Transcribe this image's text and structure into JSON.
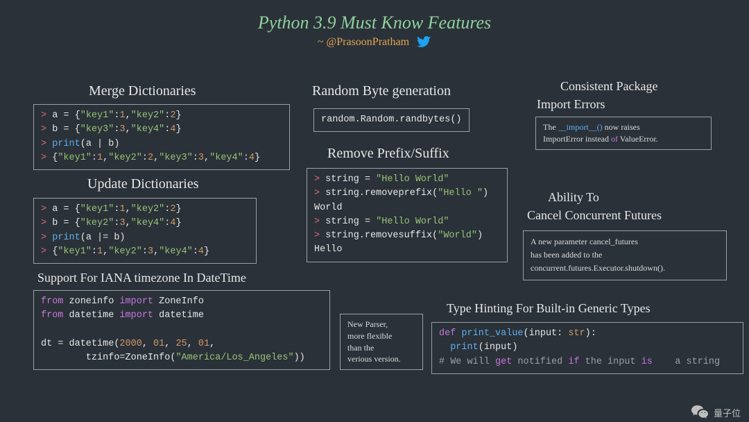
{
  "header": {
    "title": "Python 3.9 Must Know Features",
    "subtitle": "~ @PrasoonPratham"
  },
  "sections": {
    "merge_dict": {
      "heading": "Merge Dictionaries"
    },
    "update_dict": {
      "heading": "Update Dictionaries"
    },
    "iana": {
      "heading": "Support For IANA timezone In DateTime"
    },
    "random_byte": {
      "heading": "Random Byte generation",
      "code": "random.Random.randbytes()"
    },
    "remove_pre_suf": {
      "heading": "Remove Prefix/Suffix"
    },
    "consistent_pkg": {
      "heading_line1": "Consistent Package",
      "heading_line2": "Import Errors"
    },
    "cancel_futures": {
      "heading_line1": "Ability To",
      "heading_line2": "Cancel Concurrent Futures"
    },
    "type_hint": {
      "heading": "Type Hinting For Built-in Generic Types"
    }
  },
  "code": {
    "merge": {
      "l1_a": "> ",
      "l1_b": "a = {",
      "l1_c": "\"key1\"",
      "l1_d": ":",
      "l1_e": "1",
      "l1_f": ",",
      "l1_g": "\"key2\"",
      "l1_h": ":",
      "l1_i": "2",
      "l1_j": "}",
      "l2_a": "> ",
      "l2_b": "b = {",
      "l2_c": "\"key3\"",
      "l2_d": ":",
      "l2_e": "3",
      "l2_f": ",",
      "l2_g": "\"key4\"",
      "l2_h": ":",
      "l2_i": "4",
      "l2_j": "}",
      "l3_a": "> ",
      "l3_b": "print",
      "l3_c": "(a | b)",
      "l4_a": "> ",
      "l4_b": "{",
      "l4_c": "\"key1\"",
      "l4_d": ":",
      "l4_e": "1",
      "l4_f": ",",
      "l4_g": "\"key2\"",
      "l4_h": ":",
      "l4_i": "2",
      "l4_j": ",",
      "l4_k": "\"key3\"",
      "l4_l": ":",
      "l4_m": "3",
      "l4_n": ",",
      "l4_o": "\"key4\"",
      "l4_p": ":",
      "l4_q": "4",
      "l4_r": "}"
    },
    "update": {
      "l1_a": "> ",
      "l1_b": "a = {",
      "l1_c": "\"key1\"",
      "l1_d": ":",
      "l1_e": "1",
      "l1_f": ",",
      "l1_g": "\"key2\"",
      "l1_h": ":",
      "l1_i": "2",
      "l1_j": "}",
      "l2_a": "> ",
      "l2_b": "b = {",
      "l2_c": "\"key2\"",
      "l2_d": ":",
      "l2_e": "3",
      "l2_f": ",",
      "l2_g": "\"key4\"",
      "l2_h": ":",
      "l2_i": "4",
      "l2_j": "}",
      "l3_a": "> ",
      "l3_b": "print",
      "l3_c": "(a |= b)",
      "l4_a": "> ",
      "l4_b": "{",
      "l4_c": "\"key1\"",
      "l4_d": ":",
      "l4_e": "1",
      "l4_f": ",",
      "l4_g": "\"key2\"",
      "l4_h": ":",
      "l4_i": "3",
      "l4_j": ",",
      "l4_k": "\"key4\"",
      "l4_l": ":",
      "l4_m": "4",
      "l4_n": "}"
    },
    "iana": {
      "l1_a": "from",
      "l1_b": " zoneinfo ",
      "l1_c": "import",
      "l1_d": " ZoneInfo",
      "l2_a": "from",
      "l2_b": " datetime ",
      "l2_c": "import",
      "l2_d": " datetime",
      "l3_a": "dt = datetime(",
      "l3_b": "2000",
      "l3_c": ", ",
      "l3_d": "01",
      "l3_e": ", ",
      "l3_f": "25",
      "l3_g": ", ",
      "l3_h": "01",
      "l3_i": ",",
      "l4_a": "        tzinfo=ZoneInfo(",
      "l4_b": "\"America/Los_Angeles\"",
      "l4_c": "))"
    },
    "removeps": {
      "l1_a": "> ",
      "l1_b": "string = ",
      "l1_c": "\"Hello World\"",
      "l2_a": "> ",
      "l2_b": "string.removeprefix(",
      "l2_c": "\"Hello \"",
      "l2_d": ")",
      "l3": "World",
      "l4_a": "> ",
      "l4_b": "string = ",
      "l4_c": "\"Hello World\"",
      "l5_a": "> ",
      "l5_b": "string.removesuffix(",
      "l5_c": "\"World\"",
      "l5_d": ")",
      "l6": "Hello"
    },
    "typehint": {
      "l1_a": "def",
      "l1_b": " ",
      "l1_c": "print_value",
      "l1_d": "(input: ",
      "l1_e": "str",
      "l1_f": "):",
      "l2_a": "  ",
      "l2_b": "print",
      "l2_c": "(input)",
      "l3_a": "# We will ",
      "l3_b": "get",
      "l3_c": " notified ",
      "l3_d": "if",
      "l3_e": " the",
      "l3_f": " input ",
      "l3_g": "is",
      "l3_tail": "    a string"
    }
  },
  "notes": {
    "import_err_a": "The ",
    "import_err_b": "__import__()",
    "import_err_c": " now raises",
    "import_err_d": "ImportError instead ",
    "import_err_e": "of",
    "import_err_f": " ValueError.",
    "parser_a": "New Parser,",
    "parser_b": " more flexible",
    "parser_c": "than the",
    "parser_d": " verious version.",
    "cancel_a": "A new parameter cancel_futures",
    "cancel_b": "has been added to the",
    "cancel_c": "concurrent.futures.Executor.shutdown()."
  },
  "watermark": "量子位"
}
